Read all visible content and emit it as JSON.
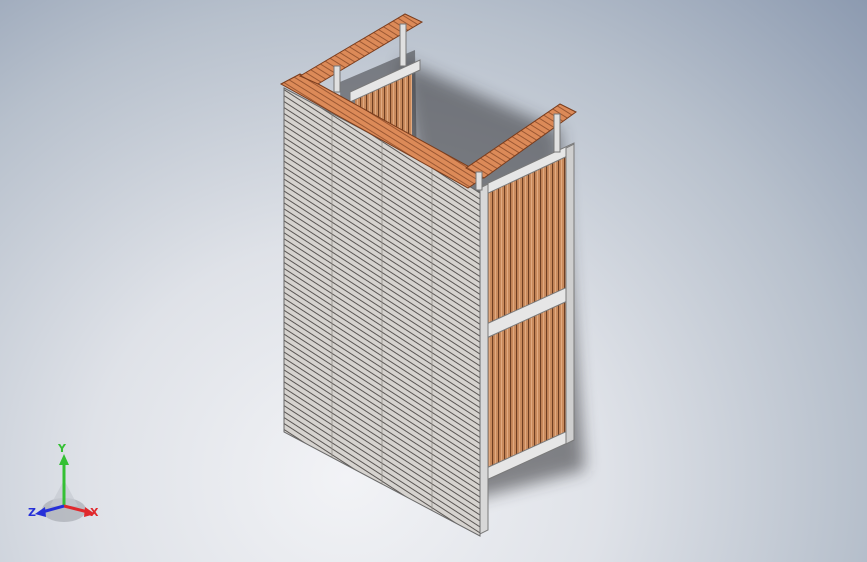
{
  "triad": {
    "x_label": "X",
    "y_label": "Y",
    "z_label": "Z",
    "x_color": "#e0282c",
    "y_color": "#34c034",
    "z_color": "#2630d8"
  },
  "colors": {
    "wood": "#d9895a",
    "wood_dark": "#a8603a",
    "mesh": "#c9c6c2",
    "frame": "#d8d8d8"
  }
}
